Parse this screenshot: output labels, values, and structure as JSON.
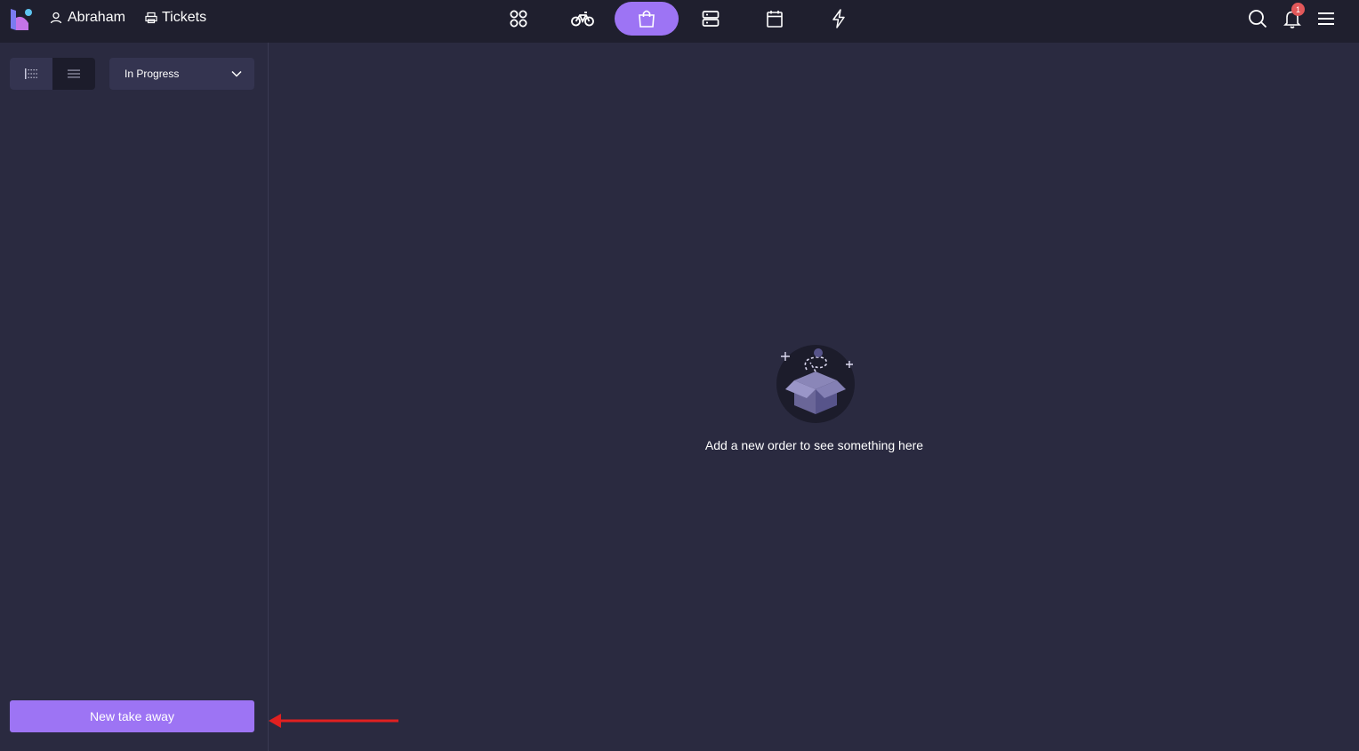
{
  "header": {
    "user_name": "Abraham",
    "tickets_label": "Tickets",
    "nav": [
      {
        "icon": "grid-icon"
      },
      {
        "icon": "bike-icon"
      },
      {
        "icon": "shopping-bag-icon",
        "active": true
      },
      {
        "icon": "server-icon"
      },
      {
        "icon": "calendar-icon"
      },
      {
        "icon": "lightning-icon"
      }
    ],
    "notification_count": "1",
    "accent_color": "#9d74f4"
  },
  "sidebar": {
    "status_filter": "In Progress",
    "new_button_label": "New take away"
  },
  "main": {
    "empty_message": "Add a new order to see something here"
  }
}
